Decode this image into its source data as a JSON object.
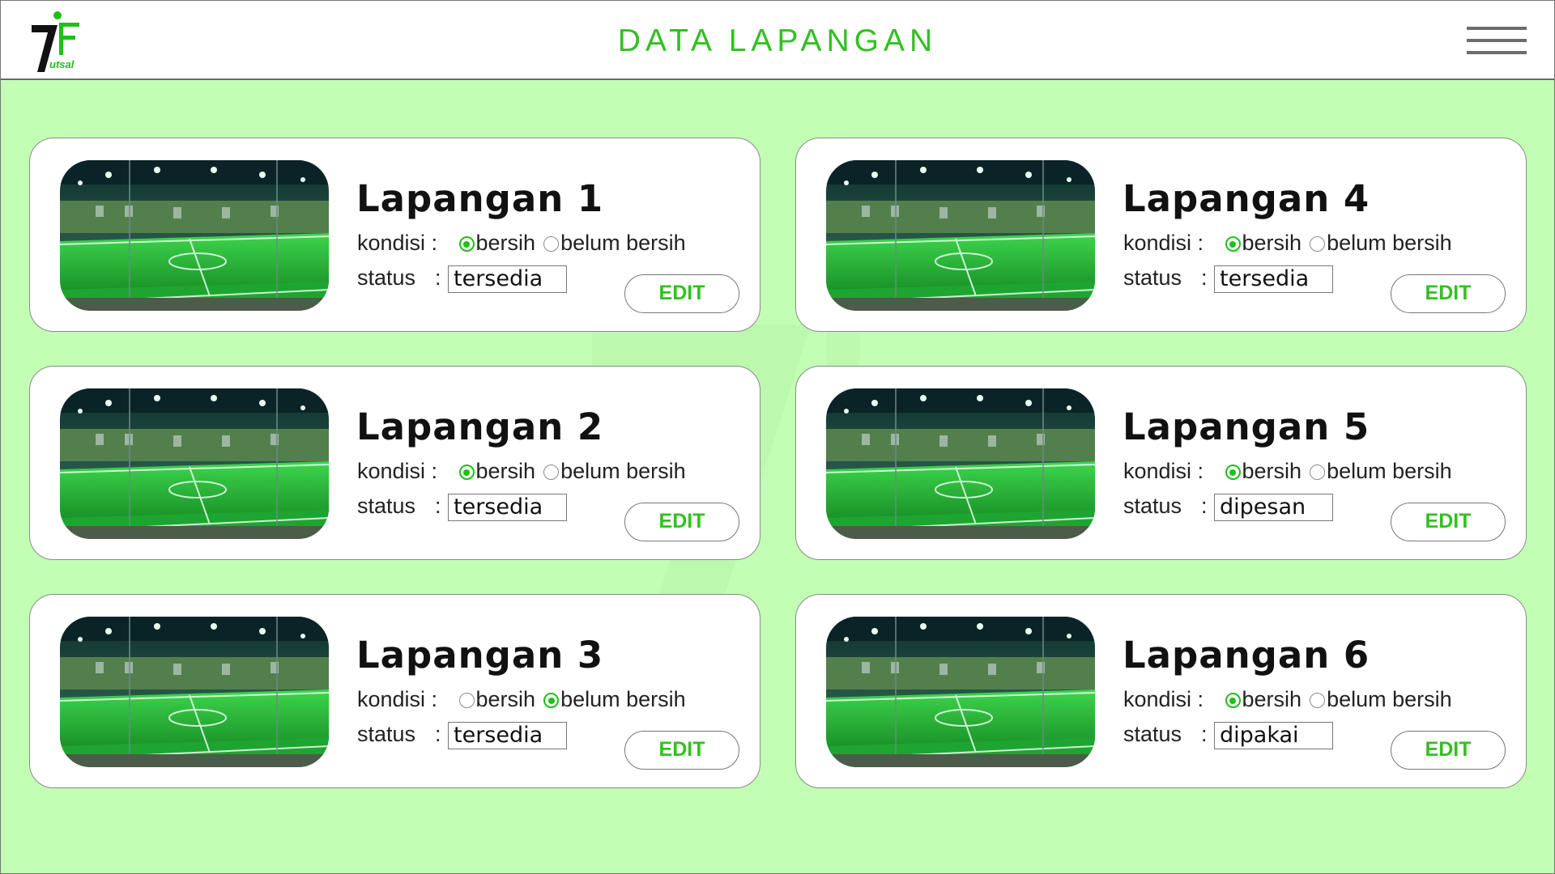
{
  "header": {
    "title": "DATA LAPANGAN",
    "logo_text": "utsal",
    "menu_icon": "hamburger-menu-icon"
  },
  "labels": {
    "kondisi": "kondisi :",
    "status": "status",
    "colon": ":",
    "opt_clean": "bersih",
    "opt_dirty": "belum bersih",
    "edit": "EDIT"
  },
  "fields": [
    {
      "name": "Lapangan 1",
      "kondisi": "bersih",
      "status": "tersedia"
    },
    {
      "name": "Lapangan 2",
      "kondisi": "bersih",
      "status": "tersedia"
    },
    {
      "name": "Lapangan 3",
      "kondisi": "belum bersih",
      "status": "tersedia"
    },
    {
      "name": "Lapangan 4",
      "kondisi": "bersih",
      "status": "tersedia"
    },
    {
      "name": "Lapangan 5",
      "kondisi": "bersih",
      "status": "dipesan"
    },
    {
      "name": "Lapangan 6",
      "kondisi": "bersih",
      "status": "dipakai"
    }
  ],
  "colors": {
    "accent": "#33c022",
    "background": "#c3feb5"
  }
}
